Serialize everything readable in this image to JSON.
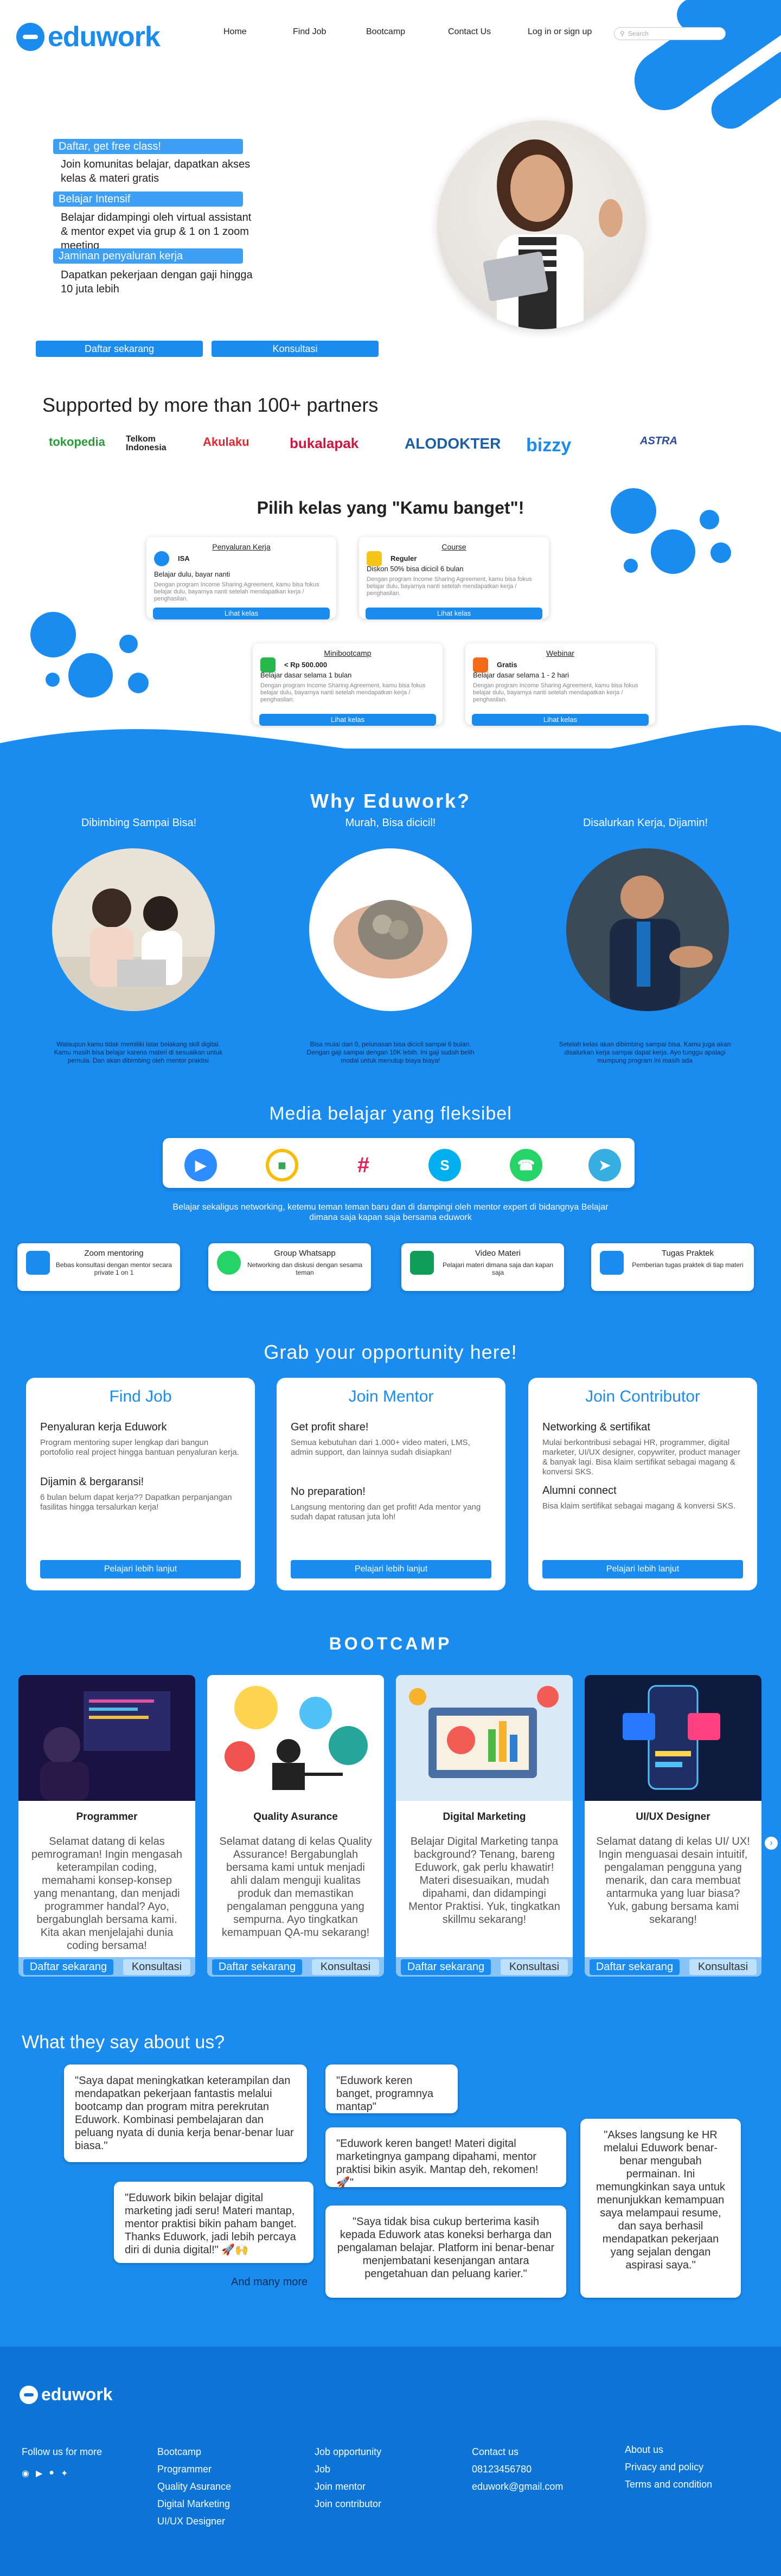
{
  "brand": {
    "name": "eduwork",
    "accent": "#1a8cf0"
  },
  "nav": {
    "home": "Home",
    "find_job": "Find Job",
    "bootcamp": "Bootcamp",
    "contact": "Contact Us",
    "login": "Log in or sign up",
    "search_placeholder": "Search"
  },
  "hero": {
    "items": [
      {
        "pill": "Daftar, get free class!",
        "text": "Join komunitas belajar, dapatkan akses kelas & materi gratis"
      },
      {
        "pill": "Belajar Intensif",
        "text": "Belajar didampingi oleh virtual assistant & mentor expet via grup & 1 on 1 zoom meeting"
      },
      {
        "pill": "Jaminan penyaluran kerja",
        "text": "Dapatkan pekerjaan dengan gaji hingga 10 juta lebih"
      }
    ],
    "btn_daftar": "Daftar sekarang",
    "btn_konsultasi": "Konsultasi"
  },
  "partners": {
    "title": "Supported by more than 100+ partners",
    "logos": [
      "tokopedia",
      "Telkom Indonesia",
      "Akulaku",
      "bukalapak",
      "ALODOKTER",
      "bizzy",
      "ASTRA"
    ]
  },
  "classes": {
    "title": "Pilih kelas yang \"Kamu banget\"!",
    "cards": [
      {
        "type": "Penyaluran Kerja",
        "price": "ISA",
        "desc": "Belajar dulu, bayar nanti",
        "small": "Dengan program Income Sharing Agreement, kamu bisa fokus belajar dulu, bayarnya nanti setelah mendapatkan kerja / penghasilan.",
        "btn": "Lihat kelas"
      },
      {
        "type": "Course",
        "price": "Reguler",
        "desc": "Diskon 50% bisa dicicil 6 bulan",
        "small": "Dengan program Income Sharing Agreement, kamu bisa fokus belajar dulu, bayarnya nanti setelah mendapatkan kerja / penghasilan.",
        "btn": "Lihat kelas"
      },
      {
        "type": "Minibootcamp",
        "price": "< Rp 500.000",
        "desc": "Belajar dasar selama 1 bulan",
        "small": "Dengan program Income Sharing Agreement, kamu bisa fokus belajar dulu, bayarnya nanti setelah mendapatkan kerja / penghasilan.",
        "btn": "Lihat kelas"
      },
      {
        "type": "Webinar",
        "price": "Gratis",
        "desc": "Belajar dasar selama 1 - 2 hari",
        "small": "Dengan program Income Sharing Agreement, kamu bisa fokus belajar dulu, bayarnya nanti setelah mendapatkan kerja / penghasilan.",
        "btn": "Lihat kelas"
      }
    ]
  },
  "why": {
    "title": "Why Eduwork?",
    "items": [
      {
        "caption": "Dibimbing Sampai Bisa!",
        "desc": "Walaupun kamu tidak memiliki latar belakang skill digital. Kamu masih bisa belajar karena materi di sesuaikan untuk pemula. Dan akan dibimbing oleh mentor praktisi"
      },
      {
        "caption": "Murah, Bisa dicicil!",
        "desc": "Bisa mulai dari 0, pelunasan bisa dicicil sampai 6 bulan. Dengan gaji sampai dengan 10K lebih. Ini gaji sudah belih modal untuk menutup biaya biaya!"
      },
      {
        "caption": "Disalurkan Kerja, Dijamin!",
        "desc": "Setelah kelas akan dibimbing sampai bisa. Kamu juga akan disalurkan kerja sampai dapat kerja. Ayo tunggu apalagi mumpung program ini masih ada"
      }
    ]
  },
  "media": {
    "title": "Media belajar yang fleksibel",
    "apps": [
      "Zoom",
      "Google Meet",
      "Slack",
      "Skype",
      "WhatsApp",
      "Telegram"
    ],
    "subtitle": "Belajar sekaligus networking, ketemu teman teman baru dan di dampingi oleh mentor expert di bidangnya Belajar dimana saja kapan saja bersama eduwork",
    "cards": [
      {
        "title": "Zoom mentoring",
        "desc": "Bebas konsultasi dengan mentor secara private 1 on 1"
      },
      {
        "title": "Group Whatsapp",
        "desc": "Networking dan diskusi dengan sesama teman"
      },
      {
        "title": "Video Materi",
        "desc": "Pelajari materi dimana saja dan kapan saja"
      },
      {
        "title": "Tugas Praktek",
        "desc": "Pemberian tugas praktek di tiap materi"
      }
    ]
  },
  "grab": {
    "title": "Grab your opportunity here!",
    "cards": [
      {
        "title": "Find Job",
        "h1": "Penyaluran kerja Eduwork",
        "d1": "Program mentoring super lengkap dari bangun portofolio real project hingga bantuan penyaluran kerja.",
        "h2": "Dijamin & bergaransi!",
        "d2": "6 bulan belum dapat kerja?? Dapatkan perpanjangan fasilitas hingga tersalurkan kerja!",
        "btn": "Pelajari lebih lanjut"
      },
      {
        "title": "Join Mentor",
        "h1": "Get profit share!",
        "d1": "Semua kebutuhan dari 1.000+ video materi, LMS, admin support, dan lainnya sudah disiapkan!",
        "h2": "No preparation!",
        "d2": "Langsung mentoring dan get profit! Ada mentor yang sudah dapat ratusan juta loh!",
        "btn": "Pelajari lebih lanjut"
      },
      {
        "title": "Join Contributor",
        "h1": "Networking & sertifikat",
        "d1": "Mulai berkontribusi sebagai HR, programmer, digital marketer, UI/UX designer, copywriter, product manager & banyak lagi. Bisa klaim sertifikat sebagai magang & konversi SKS.",
        "h2": "Alumni connect",
        "d2": "Bisa klaim sertifikat sebagai magang & konversi SKS.",
        "btn": "Pelajari lebih lanjut"
      }
    ]
  },
  "bootcamp": {
    "title": "BOOTCAMP",
    "cards": [
      {
        "title": "Programmer",
        "desc": "Selamat datang di kelas pemrograman! Ingin mengasah keterampilan coding, memahami konsep-konsep yang menantang, dan menjadi programmer handal? Ayo, bergabunglah bersama kami. Kita akan menjelajahi dunia coding bersama!"
      },
      {
        "title": "Quality Asurance",
        "desc": "Selamat datang di kelas Quality Assurance! Bergabunglah bersama kami untuk menjadi ahli dalam menguji kualitas produk dan memastikan pengalaman pengguna yang sempurna. Ayo tingkatkan kemampuan QA-mu sekarang!"
      },
      {
        "title": "Digital Marketing",
        "desc": "Belajar Digital Marketing tanpa background? Tenang, bareng Eduwork, gak perlu khawatir! Materi disesuaikan, mudah dipahami, dan didampingi Mentor Praktisi. Yuk, tingkatkan skillmu sekarang!"
      },
      {
        "title": "UI/UX Designer",
        "desc": "Selamat datang di kelas UI/ UX! Ingin menguasai desain intuitif, pengalaman pengguna yang menarik, dan cara membuat antarmuka yang luar biasa? Yuk, gabung bersama kami sekarang!"
      }
    ],
    "btn_daftar": "Daftar sekarang",
    "btn_konsultasi": "Konsultasi"
  },
  "testimonials": {
    "title": "What they say about us?",
    "items": [
      "\"Saya dapat meningkatkan keterampilan dan mendapatkan pekerjaan fantastis melalui bootcamp dan program mitra perekrutan Eduwork. Kombinasi pembelajaran dan peluang nyata di dunia kerja benar-benar luar biasa.\"",
      "\"Eduwork keren banget, programnya mantap\"",
      "\"Eduwork keren banget! Materi digital marketingnya gampang dipahami, mentor praktisi bikin asyik. Mantap deh, rekomen! 🚀\"",
      "\"Eduwork bikin belajar digital marketing jadi seru! Materi mantap, mentor praktisi bikin paham banget. Thanks Eduwork, jadi lebih percaya diri di dunia digital!\" 🚀🙌",
      "\"Saya tidak bisa cukup berterima kasih kepada Eduwork atas koneksi berharga dan pengalaman belajar. Platform ini benar-benar menjembatani kesenjangan antara pengetahuan dan peluang karier.\"",
      "\"Akses langsung ke HR melalui Eduwork benar-benar mengubah permainan. Ini memungkinkan saya untuk menunjukkan kemampuan saya melampaui resume, dan saya berhasil mendapatkan pekerjaan yang sejalan dengan aspirasi saya.\""
    ],
    "more": "And many more"
  },
  "footer": {
    "follow": "Follow us for more",
    "bootcamp_h": "Bootcamp",
    "bootcamp": [
      "Programmer",
      "Quality Asurance",
      "Digital Marketing",
      "UI/UX Designer"
    ],
    "job_h": "Job opportunity",
    "job": [
      "Job",
      "Join mentor",
      "Join contributor"
    ],
    "contact_h": "Contact us",
    "phone": "08123456780",
    "email": "eduwork@gmail.com",
    "about": "About us",
    "privacy": "Privacy and policy",
    "terms": "Terms and condition"
  }
}
